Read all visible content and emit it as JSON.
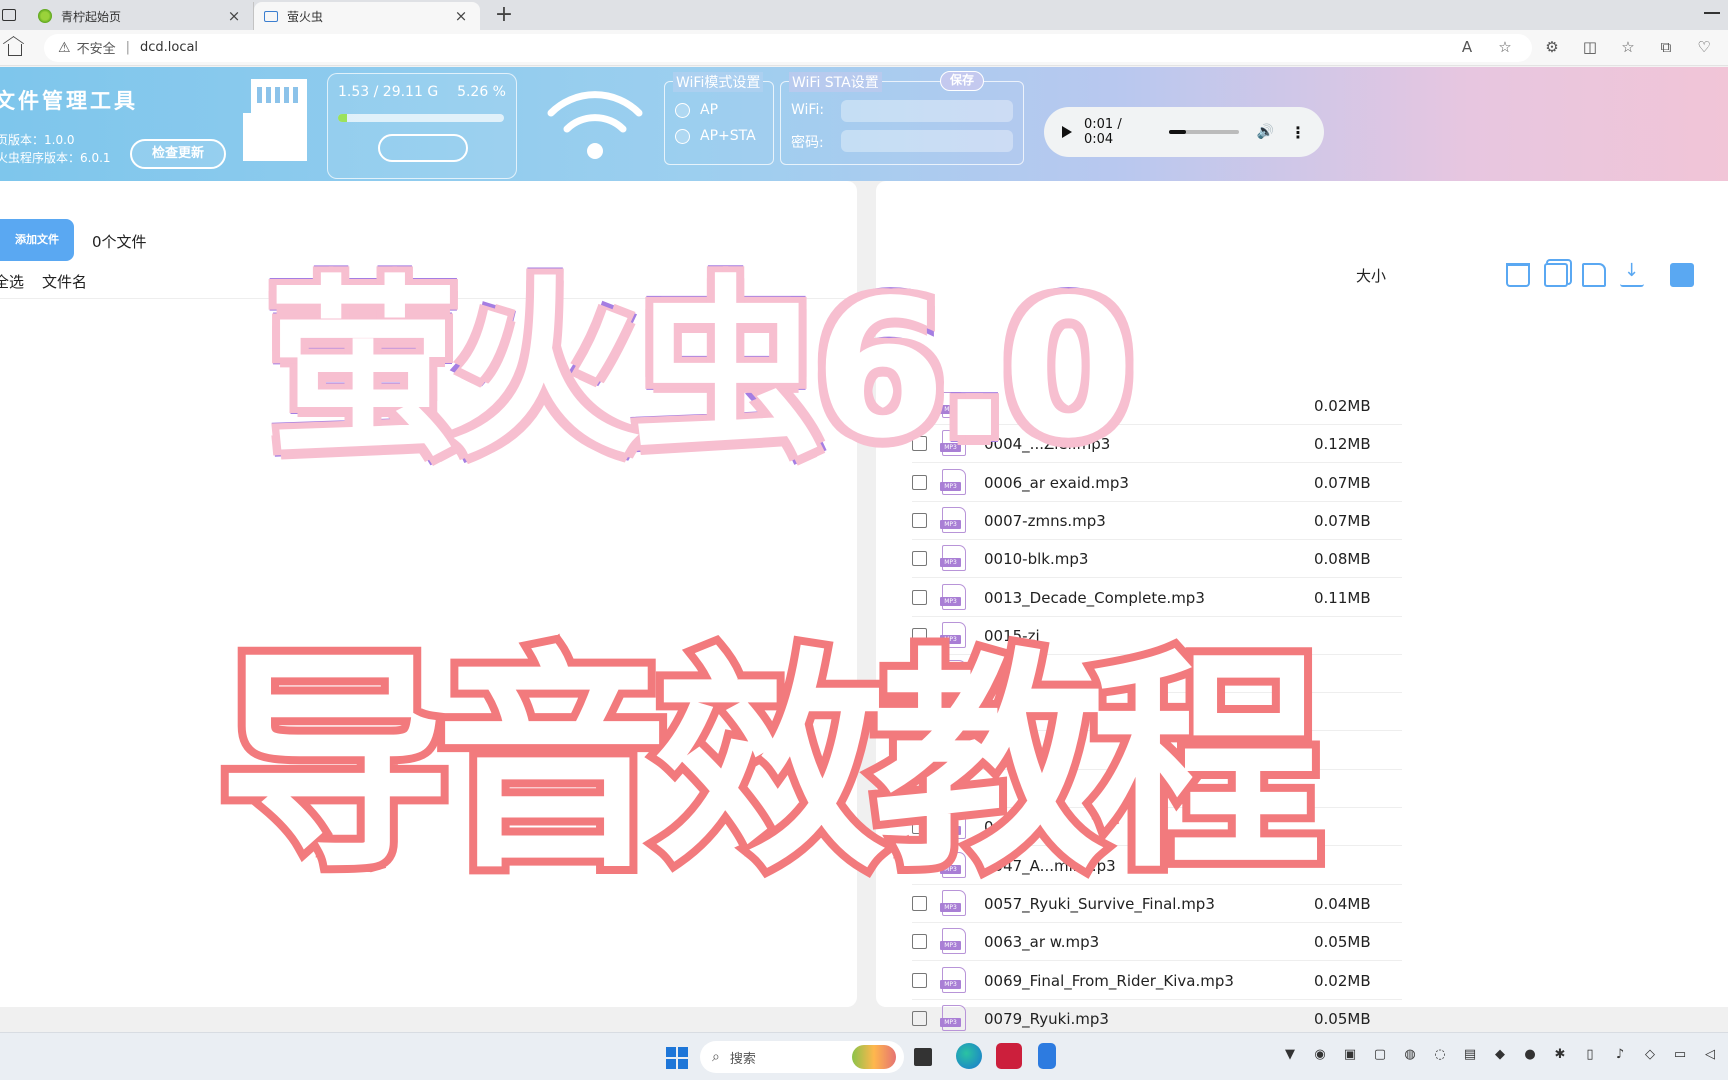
{
  "browser": {
    "tabs": [
      {
        "title": "青柠起始页",
        "close": "×",
        "icon": "leaf-favicon"
      },
      {
        "title": "萤火虫",
        "close": "×",
        "icon": "folder-favicon"
      }
    ],
    "new_tab": "+",
    "address": {
      "security": "不安全",
      "separator": "|",
      "url": "dcd.local"
    }
  },
  "header": {
    "app_title": "文件管理工具",
    "page_version": "页版本：1.0.0",
    "firmware_version": "火虫程序版本：6.0.1",
    "check_update": "检查更新",
    "storage": {
      "used_text": "1.53 / 29.11 G",
      "percent_text": "5.26 %",
      "percent": 5.26
    },
    "wifi_mode": {
      "legend": "WiFi模式设置",
      "options": [
        "AP",
        "AP+STA"
      ]
    },
    "wifi_sta": {
      "legend": "WiFi STA设置",
      "save": "保存",
      "wifi_label": "WiFi:",
      "password_label": "密码:"
    },
    "audio": {
      "time": "0:01 / 0:04",
      "progress": 0.25
    }
  },
  "left_pane": {
    "add_button": "添加文件",
    "file_count": "0个文件",
    "select_all": "全选",
    "filename_header": "文件名"
  },
  "right_pane": {
    "size_header": "大小",
    "files": [
      {
        "name": "",
        "size": "0.02MB"
      },
      {
        "name": "0004_...Ziel.mp3",
        "size": "0.12MB"
      },
      {
        "name": "0006_ar exaid.mp3",
        "size": "0.07MB"
      },
      {
        "name": "0007-zmns.mp3",
        "size": "0.07MB"
      },
      {
        "name": "0010-blk.mp3",
        "size": "0.08MB"
      },
      {
        "name": "0013_Decade_Complete.mp3",
        "size": "0.11MB"
      },
      {
        "name": "0015-zi",
        "size": ""
      },
      {
        "name": "00",
        "size": ""
      },
      {
        "name": "0",
        "size": ""
      },
      {
        "name": "00",
        "size": ""
      },
      {
        "name": "0",
        "size": ""
      },
      {
        "name": "0",
        "size": ""
      },
      {
        "name": "0047_A...min...p3",
        "size": ""
      },
      {
        "name": "0057_Ryuki_Survive_Final.mp3",
        "size": "0.04MB"
      },
      {
        "name": "0063_ar w.mp3",
        "size": "0.05MB"
      },
      {
        "name": "0069_Final_From_Rider_Kiva.mp3",
        "size": "0.02MB"
      },
      {
        "name": "0079_Ryuki.mp3",
        "size": "0.05MB"
      }
    ],
    "file_badge": "MP3"
  },
  "overlay": {
    "title_line1": "萤火虫6.0",
    "title_line2": "导音效教程"
  },
  "taskbar": {
    "search_placeholder": "搜索"
  },
  "colors": {
    "accent": "#5aa8f2",
    "title_purple": "#a57ee2",
    "title_red": "#f27a7d",
    "mp3_icon": "#a97fd5"
  }
}
